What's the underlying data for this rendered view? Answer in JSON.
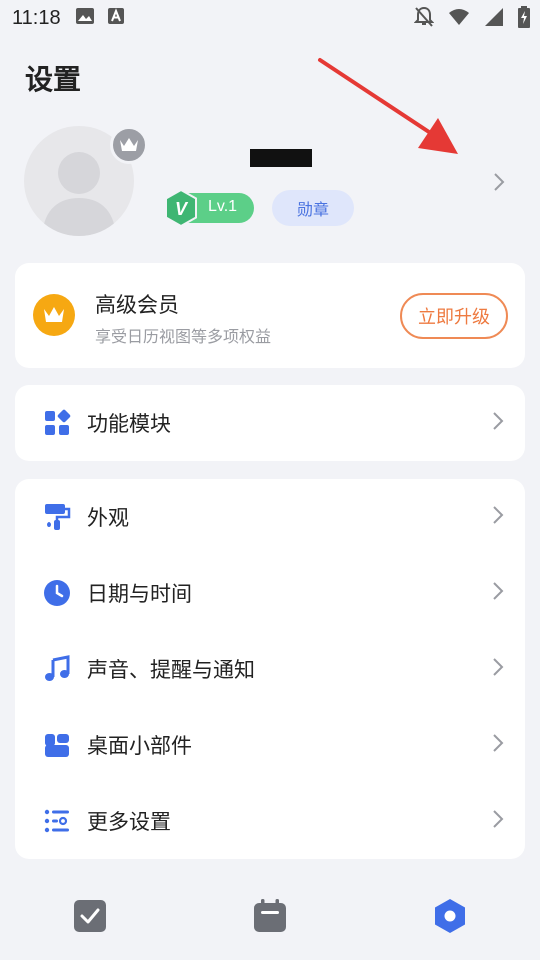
{
  "status_bar": {
    "time": "11:18",
    "icons": [
      "image-icon",
      "text-a-icon",
      "notifications-off-icon",
      "wifi-icon",
      "signal-icon",
      "battery-charging-icon"
    ]
  },
  "header": {
    "title": "设置"
  },
  "profile": {
    "level_label": "Lv.1",
    "level_letter": "V",
    "medal_label": "勋章"
  },
  "vip": {
    "title": "高级会员",
    "subtitle": "享受日历视图等多项权益",
    "upgrade_label": "立即升级"
  },
  "modules": {
    "label": "功能模块"
  },
  "settings_items": [
    {
      "label": "外观",
      "icon": "paint-roller-icon"
    },
    {
      "label": "日期与时间",
      "icon": "clock-icon"
    },
    {
      "label": "声音、提醒与通知",
      "icon": "music-note-icon"
    },
    {
      "label": "桌面小部件",
      "icon": "widgets-icon"
    },
    {
      "label": "更多设置",
      "icon": "list-settings-icon"
    }
  ],
  "bottom_nav": [
    "tasks-tab",
    "calendar-tab",
    "settings-tab"
  ],
  "colors": {
    "accent_blue": "#3f6ee8",
    "vip_gold": "#f6a812",
    "upgrade_orange": "#ee7a40",
    "level_green": "#5ccf88",
    "annotation_red": "#e53935"
  }
}
